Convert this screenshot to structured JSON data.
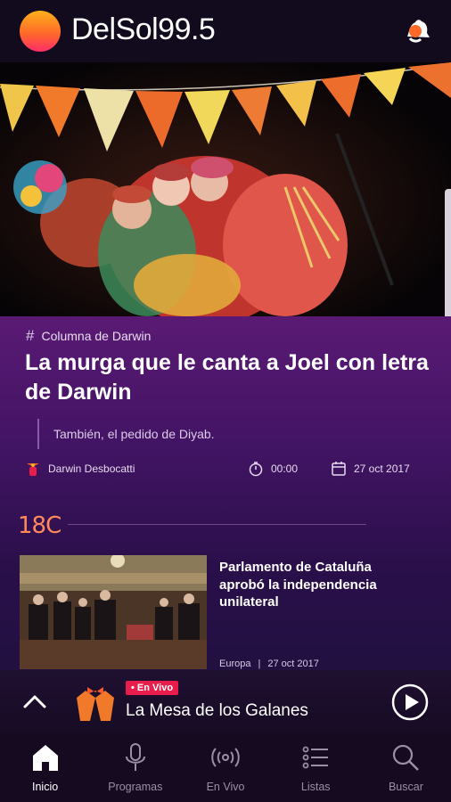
{
  "header": {
    "logo_text": "DelSol99.5",
    "notifications_icon": "bell-icon"
  },
  "hero": {
    "image": "murga-performers-photo"
  },
  "article": {
    "section": "Columna de Darwin",
    "title": "La murga que le canta a Joel con letra de Darwin",
    "subtitle": "También, el pedido de Diyab.",
    "author": "Darwin Desbocatti",
    "duration": "00:00",
    "date": "27 oct 2017"
  },
  "weather": {
    "temperature": "18C"
  },
  "news": {
    "title": "Parlamento de Cataluña aprobó la independencia unilateral",
    "category": "Europa",
    "separator": "|",
    "date": "27 oct 2017"
  },
  "player": {
    "live_label": "• En Vivo",
    "show_title": "La Mesa de los Galanes"
  },
  "nav": {
    "items": [
      {
        "label": "Inicio",
        "icon": "home-icon"
      },
      {
        "label": "Programas",
        "icon": "microphone-icon"
      },
      {
        "label": "En Vivo",
        "icon": "broadcast-icon"
      },
      {
        "label": "Listas",
        "icon": "list-icon"
      },
      {
        "label": "Buscar",
        "icon": "search-icon"
      }
    ],
    "active": "Inicio"
  },
  "colors": {
    "accent": "#e81d4c",
    "header_bg": "#120a1d",
    "article_bg": "#4a156b",
    "temp": "#ff8a5a"
  }
}
